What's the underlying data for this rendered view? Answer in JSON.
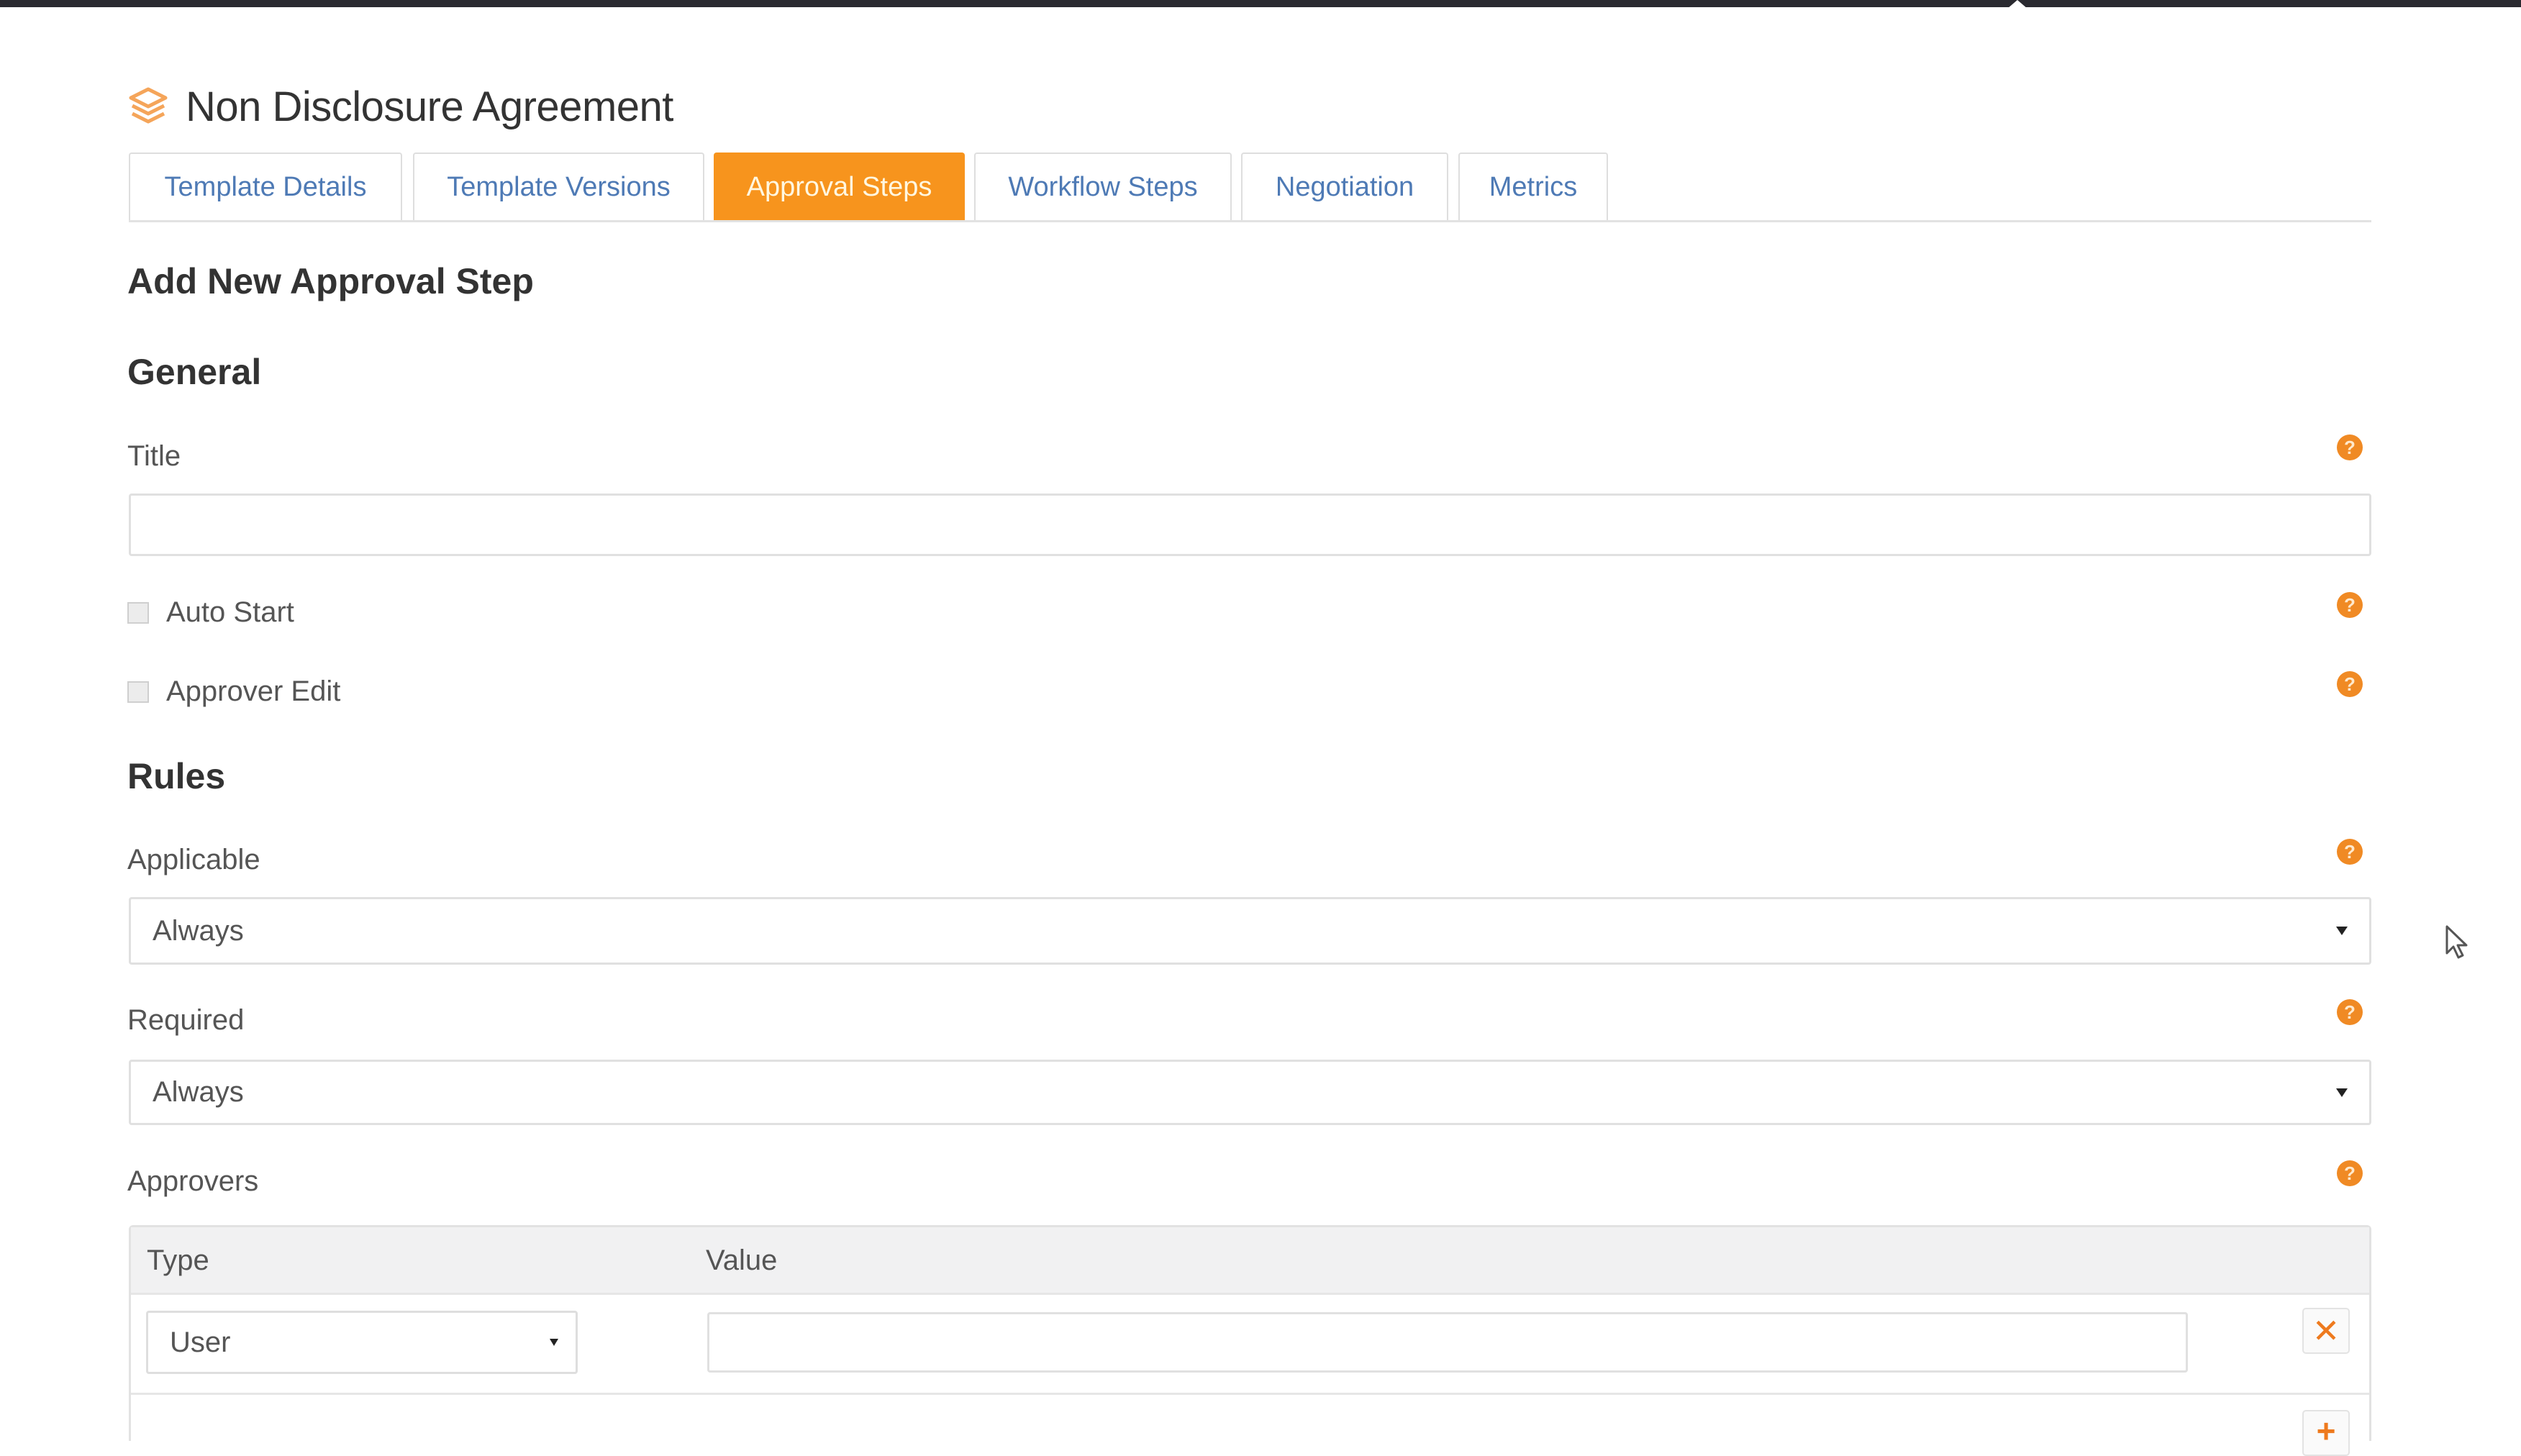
{
  "header": {
    "icon": "layers-icon",
    "title": "Non Disclosure Agreement"
  },
  "tabs": [
    {
      "label": "Template Details",
      "active": false
    },
    {
      "label": "Template Versions",
      "active": false
    },
    {
      "label": "Approval Steps",
      "active": true
    },
    {
      "label": "Workflow Steps",
      "active": false
    },
    {
      "label": "Negotiation",
      "active": false
    },
    {
      "label": "Metrics",
      "active": false
    }
  ],
  "form": {
    "heading": "Add New Approval Step",
    "general": {
      "section_title": "General",
      "title_label": "Title",
      "title_value": "",
      "auto_start_label": "Auto Start",
      "auto_start_checked": false,
      "approver_edit_label": "Approver Edit",
      "approver_edit_checked": false
    },
    "rules": {
      "section_title": "Rules",
      "applicable_label": "Applicable",
      "applicable_value": "Always",
      "required_label": "Required",
      "required_value": "Always",
      "approvers_label": "Approvers",
      "approvers_table": {
        "columns": [
          "Type",
          "Value"
        ],
        "rows": [
          {
            "type": "User",
            "value": ""
          }
        ]
      }
    },
    "help_icon_glyph": "?",
    "remove_icon_glyph": "✕",
    "add_icon_glyph": "+"
  },
  "colors": {
    "accent": "#f7941d",
    "tab_text": "#4e7ab5",
    "help_icon": "#f08a24",
    "top_bar": "#2a2a30"
  }
}
